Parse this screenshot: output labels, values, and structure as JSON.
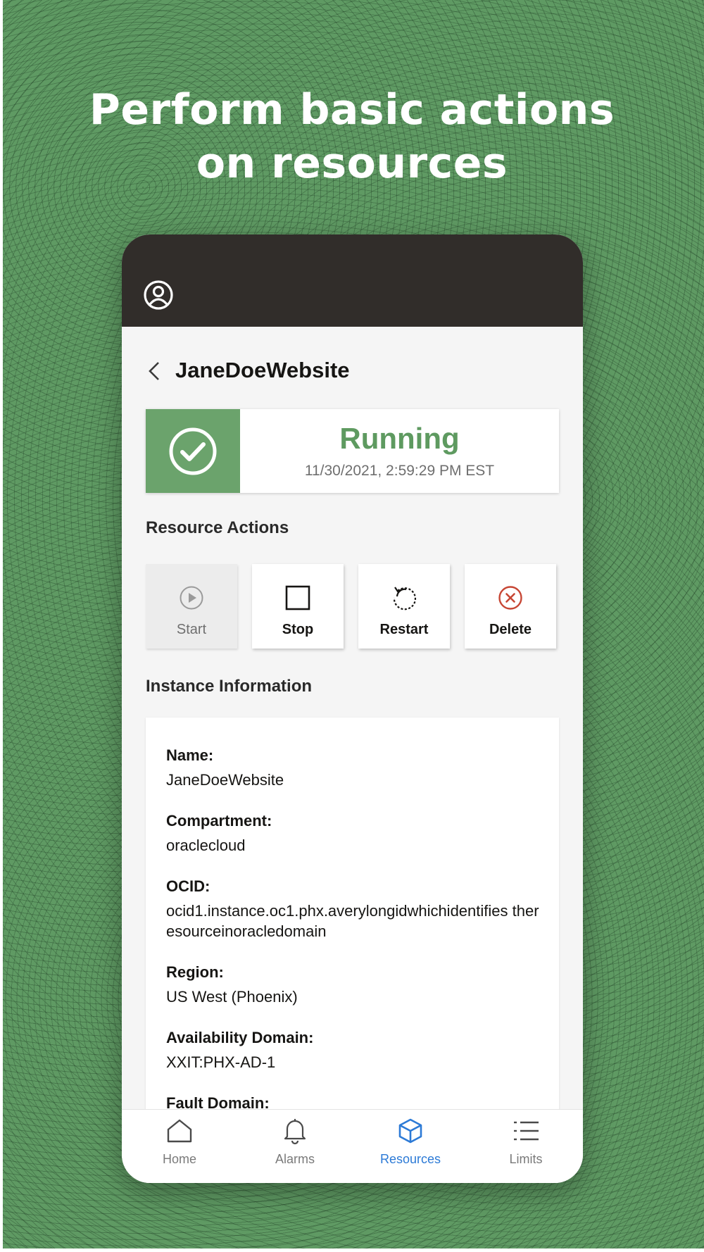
{
  "headline": {
    "line1": "Perform basic actions",
    "line2": "on resources"
  },
  "header": {
    "profile_icon": "user-circle-icon"
  },
  "page": {
    "back_icon": "chevron-left-icon",
    "title": "JaneDoeWebsite"
  },
  "status": {
    "icon": "check-circle-icon",
    "label": "Running",
    "timestamp": "11/30/2021, 2:59:29 PM EST",
    "color": "#5e9a60"
  },
  "resource_actions": {
    "title": "Resource Actions",
    "items": [
      {
        "label": "Start",
        "icon": "play-circle-icon",
        "enabled": false
      },
      {
        "label": "Stop",
        "icon": "stop-square-icon",
        "enabled": true
      },
      {
        "label": "Restart",
        "icon": "restart-icon",
        "enabled": true
      },
      {
        "label": "Delete",
        "icon": "delete-circle-icon",
        "enabled": true,
        "color": "#c74634"
      }
    ]
  },
  "instance_info": {
    "title": "Instance Information",
    "fields": [
      {
        "label": "Name:",
        "value": "JaneDoeWebsite"
      },
      {
        "label": "Compartment:",
        "value": "oraclecloud"
      },
      {
        "label": "OCID:",
        "value": "ocid1.instance.oc1.phx.averylongidwhichidentifies theresourceinoracledomain"
      },
      {
        "label": "Region:",
        "value": "US West (Phoenix)"
      },
      {
        "label": "Availability Domain:",
        "value": "XXIT:PHX-AD-1"
      },
      {
        "label": "Fault Domain:",
        "value": ""
      }
    ]
  },
  "tabbar": {
    "active": "Resources",
    "active_color": "#2c7ad6",
    "items": [
      {
        "label": "Home",
        "icon": "home-icon"
      },
      {
        "label": "Alarms",
        "icon": "bell-icon"
      },
      {
        "label": "Resources",
        "icon": "cube-icon"
      },
      {
        "label": "Limits",
        "icon": "list-icon"
      }
    ]
  }
}
